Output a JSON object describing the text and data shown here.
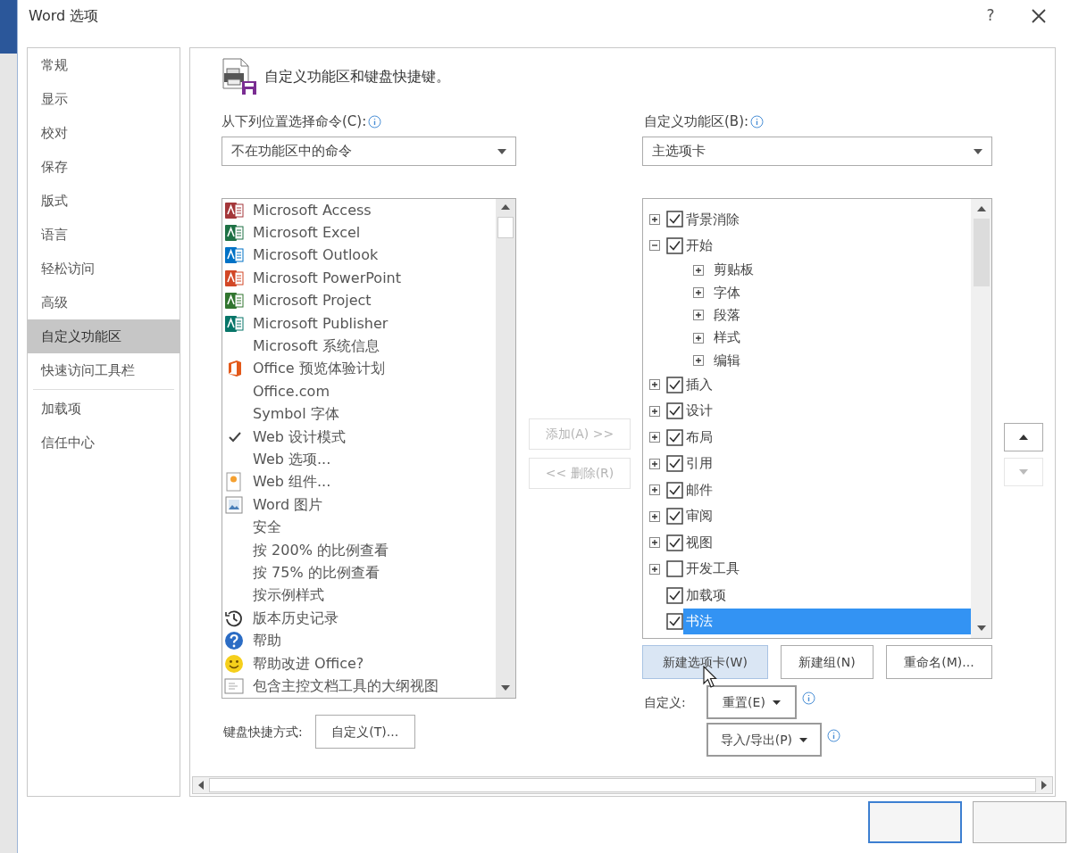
{
  "window": {
    "title": "Word 选项",
    "help": "?"
  },
  "sidebar": {
    "sections": [
      [
        {
          "label": "常规",
          "selected": false
        },
        {
          "label": "显示",
          "selected": false
        },
        {
          "label": "校对",
          "selected": false
        },
        {
          "label": "保存",
          "selected": false
        },
        {
          "label": "版式",
          "selected": false
        },
        {
          "label": "语言",
          "selected": false
        },
        {
          "label": "轻松访问",
          "selected": false
        },
        {
          "label": "高级",
          "selected": false
        },
        {
          "label": "自定义功能区",
          "selected": true
        },
        {
          "label": "快速访问工具栏",
          "selected": false
        }
      ],
      [
        {
          "label": "加载项",
          "selected": false
        },
        {
          "label": "信任中心",
          "selected": false
        }
      ]
    ]
  },
  "header": "自定义功能区和键盘快捷键。",
  "commands": {
    "label": "从下列位置选择命令(C):",
    "dropdown": "不在功能区中的命令",
    "items": [
      {
        "label": "Microsoft Access",
        "kind": "access",
        "checked": false
      },
      {
        "label": "Microsoft Excel",
        "kind": "excel",
        "checked": false
      },
      {
        "label": "Microsoft Outlook",
        "kind": "outlook",
        "checked": false
      },
      {
        "label": "Microsoft PowerPoint",
        "kind": "powerpoint",
        "checked": false
      },
      {
        "label": "Microsoft Project",
        "kind": "project",
        "checked": false
      },
      {
        "label": "Microsoft Publisher",
        "kind": "publisher",
        "checked": false
      },
      {
        "label": "Microsoft 系统信息",
        "checked": false
      },
      {
        "label": "Office 预览体验计划",
        "kind": "office",
        "checked": false
      },
      {
        "label": "Office.com",
        "checked": false
      },
      {
        "label": "Symbol 字体",
        "checked": false
      },
      {
        "label": "Web 设计模式",
        "checked": true
      },
      {
        "label": "Web 选项...",
        "checked": false
      },
      {
        "label": "Web 组件...",
        "kind": "component",
        "checked": false
      },
      {
        "label": "Word 图片",
        "kind": "picture",
        "checked": false
      },
      {
        "label": "安全",
        "checked": false
      },
      {
        "label": "按 200% 的比例查看",
        "checked": false
      },
      {
        "label": "按 75% 的比例查看",
        "checked": false
      },
      {
        "label": "按示例样式",
        "checked": false
      },
      {
        "label": "版本历史记录",
        "kind": "history",
        "checked": false
      },
      {
        "label": "帮助",
        "kind": "help",
        "checked": false
      },
      {
        "label": "帮助改进 Office?",
        "kind": "smiley",
        "checked": false
      },
      {
        "label": "包含主控文档工具的大纲视图",
        "kind": "outline",
        "checked": false
      }
    ]
  },
  "add_button": {
    "label": "添加(A) >>",
    "disabled": true
  },
  "remove_button": {
    "label": "<< 删除(R)",
    "disabled": true
  },
  "ribbon": {
    "label": "自定义功能区(B):",
    "dropdown": "主选项卡",
    "tree": [
      {
        "kind": "tab",
        "label": "背景消除",
        "checked": true,
        "expanded": false,
        "selected": false
      },
      {
        "kind": "tab",
        "label": "开始",
        "checked": true,
        "expanded": true,
        "selected": false,
        "children": [
          {
            "kind": "group",
            "label": "剪贴板",
            "expanded": false,
            "selected": false
          },
          {
            "kind": "group",
            "label": "字体",
            "expanded": false,
            "selected": false
          },
          {
            "kind": "group",
            "label": "段落",
            "expanded": false,
            "selected": false
          },
          {
            "kind": "group",
            "label": "样式",
            "expanded": false,
            "selected": false
          },
          {
            "kind": "group",
            "label": "编辑",
            "expanded": false,
            "selected": false
          }
        ]
      },
      {
        "kind": "tab",
        "label": "插入",
        "checked": true,
        "expanded": false,
        "selected": false
      },
      {
        "kind": "tab",
        "label": "设计",
        "checked": true,
        "expanded": false,
        "selected": false
      },
      {
        "kind": "tab",
        "label": "布局",
        "checked": true,
        "expanded": false,
        "selected": false
      },
      {
        "kind": "tab",
        "label": "引用",
        "checked": true,
        "expanded": false,
        "selected": false
      },
      {
        "kind": "tab",
        "label": "邮件",
        "checked": true,
        "expanded": false,
        "selected": false
      },
      {
        "kind": "tab",
        "label": "审阅",
        "checked": true,
        "expanded": false,
        "selected": false
      },
      {
        "kind": "tab",
        "label": "视图",
        "checked": true,
        "expanded": false,
        "selected": false
      },
      {
        "kind": "tab",
        "label": "开发工具",
        "checked": false,
        "expanded": false,
        "selected": false
      },
      {
        "kind": "tab",
        "label": "加载项",
        "checked": true,
        "selected": false
      },
      {
        "kind": "tab",
        "label": "书法",
        "checked": true,
        "selected": true
      }
    ]
  },
  "move_buttons": [
    {
      "kind": "up",
      "disabled": false
    },
    {
      "kind": "down",
      "disabled": true
    }
  ],
  "tree_buttons": [
    {
      "label": "新建选项卡(W)",
      "hovered": true
    },
    {
      "label": "新建组(N)",
      "hovered": false
    },
    {
      "label": "重命名(M)...",
      "hovered": false
    }
  ],
  "customizations": {
    "label": "自定义:",
    "reset": "重置(E)",
    "import_export": "导入/导出(P)"
  },
  "keyboard": {
    "label": "键盘快捷方式:",
    "button": "自定义(T)..."
  }
}
